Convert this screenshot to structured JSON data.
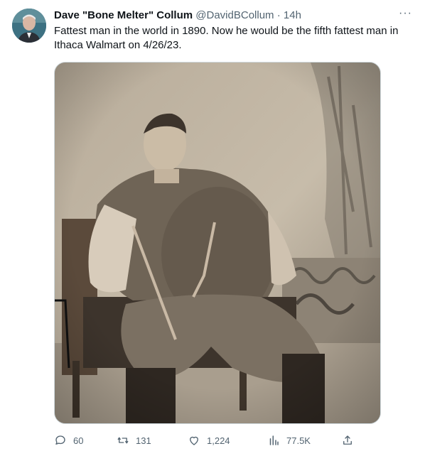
{
  "author": {
    "name": "Dave \"Bone Melter\" Collum",
    "handle": "@DavidBCollum",
    "separator": "·",
    "time": "14h"
  },
  "tweet": {
    "text": "Fattest man in the world in 1890. Now he would be the fifth fattest man in Ithaca Walmart on 4/26/23."
  },
  "more_icon": "···",
  "actions": {
    "reply": "60",
    "retweet": "131",
    "like": "1,224",
    "views": "77.5K"
  },
  "icons": [
    "reply-icon",
    "retweet-icon",
    "like-icon",
    "views-icon",
    "share-icon",
    "more-icon"
  ],
  "colors": {
    "text": "#0f1419",
    "secondary": "#536471",
    "border": "#cfd9de"
  }
}
